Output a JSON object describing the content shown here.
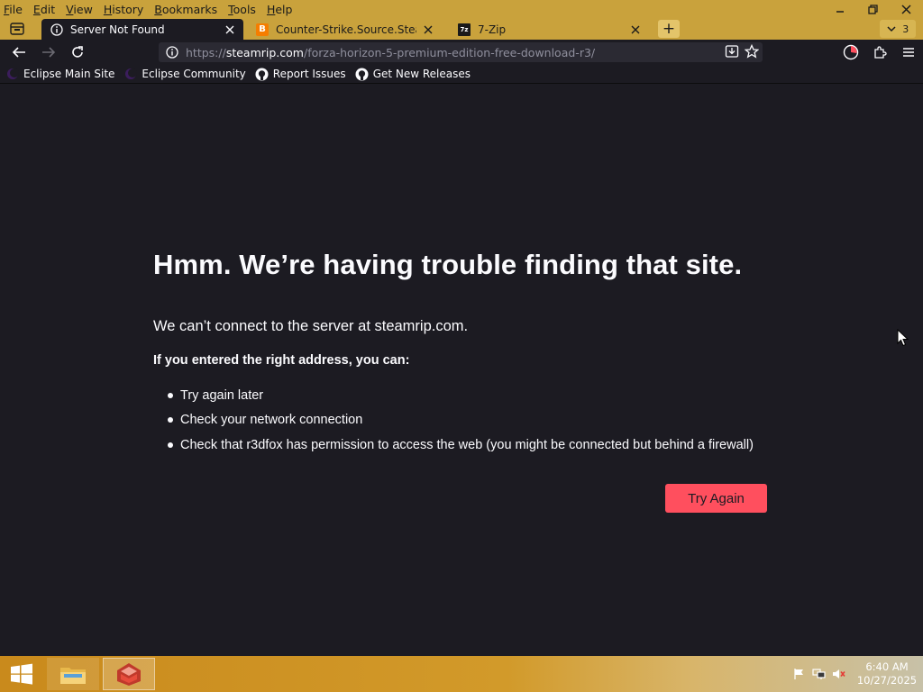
{
  "menu": [
    "File",
    "Edit",
    "View",
    "History",
    "Bookmarks",
    "Tools",
    "Help"
  ],
  "window_controls": {
    "minimize": "–",
    "restore": "❐",
    "close": "✕"
  },
  "tabs": [
    {
      "title": "Server Not Found",
      "active": true,
      "favicon": "info-icon"
    },
    {
      "title": "Counter-Strike.Source.SteamRIP",
      "active": false,
      "favicon": "blogger-b-icon",
      "favicon_letter": "B"
    },
    {
      "title": "7-Zip",
      "active": false,
      "favicon": "7zip-icon",
      "favicon_letter": "7z"
    }
  ],
  "new_tab_label": "+",
  "tab_count": "3",
  "url": {
    "scheme": "https://",
    "host": "steamrip.com",
    "path": "/forza-horizon-5-premium-edition-free-download-r3/"
  },
  "bookmarks": [
    {
      "label": "Eclipse Main Site",
      "icon": "eclipse-icon"
    },
    {
      "label": "Eclipse Community",
      "icon": "eclipse-icon"
    },
    {
      "label": "Report Issues",
      "icon": "github-icon"
    },
    {
      "label": "Get New Releases",
      "icon": "github-icon"
    }
  ],
  "error": {
    "title": "Hmm. We’re having trouble finding that site.",
    "description": "We can’t connect to the server at steamrip.com.",
    "hint": "If you entered the right address, you can:",
    "suggestions": [
      "Try again later",
      "Check your network connection",
      "Check that r3dfox has permission to access the web (you might be connected but behind a firewall)"
    ],
    "button": "Try Again"
  },
  "clock": {
    "time": "6:40 AM",
    "date": "10/27/2025"
  },
  "colors": {
    "accent": "#ff4f5e",
    "titlebar": "#c9a23c",
    "background": "#1c1b22"
  }
}
